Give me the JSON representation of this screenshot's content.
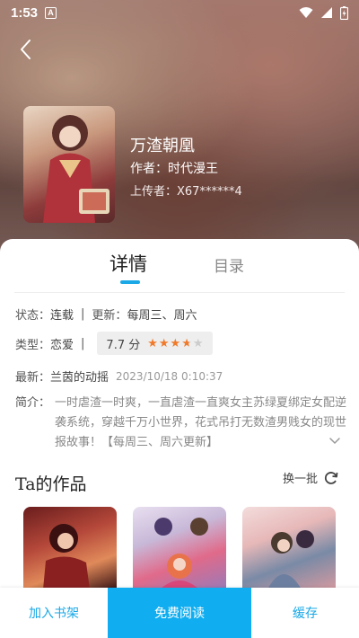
{
  "status_bar": {
    "time": "1:53",
    "notification_glyph": "A"
  },
  "book": {
    "title": "万渣朝凰",
    "author": "作者：时代漫王",
    "uploader": "上传者：X67******4"
  },
  "tabs": {
    "details": "详情",
    "catalog": "目录"
  },
  "info": {
    "status_label": "状态：",
    "status_value": "连载",
    "separator": "|",
    "update_label": "更新：",
    "update_value": "每周三、周六",
    "type_label": "类型：",
    "type_value": "恋爱",
    "rating": "7.7 分",
    "rating_stars": 3.7,
    "latest_label": "最新：",
    "latest_value": "兰茵的动摇",
    "latest_time": "2023/10/18 0:10:37",
    "summary_label": "简介：",
    "summary_text": "一时虐渣一时爽，一直虐渣一直爽女主苏绿夏绑定女配逆袭系统，穿越千万小世界，花式吊打无数渣男贱女的现世报故事！【每周三、周六更新】"
  },
  "works": {
    "title": "Ta的作品",
    "refresh_label": "换一批"
  },
  "bottom_bar": {
    "add_shelf": "加入书架",
    "read_free": "免费阅读",
    "cache": "缓存"
  },
  "colors": {
    "accent": "#10aef0",
    "star": "#f07a2a"
  }
}
